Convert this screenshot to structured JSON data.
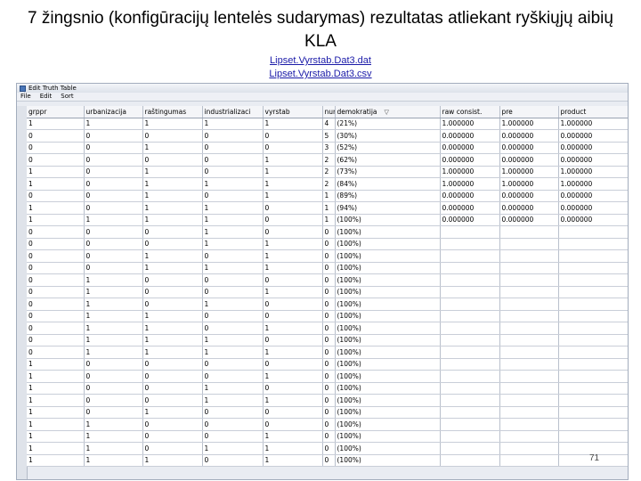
{
  "slide": {
    "title": "7 žingsnio (konfigūracijų lentelės sudarymas) rezultatas atliekant ryškiųjų aibių KLA",
    "links": [
      "Lipset.Vyrstab.Dat3.dat",
      "Lipset.Vyrstab.Dat3.csv"
    ],
    "page_number": "71"
  },
  "window": {
    "title": "Edit Truth Table",
    "menu": [
      "File",
      "Edit",
      "Sort"
    ]
  },
  "table": {
    "columns": [
      "grppr",
      "urbanizacija",
      "raštingumas",
      "industrializaci",
      "vyrstab",
      "number",
      "demokratija",
      "raw consist.",
      "pre",
      "product"
    ],
    "rows": [
      [
        "1",
        "1",
        "1",
        "1",
        "1",
        "4",
        "(21%)",
        "1.000000",
        "1.000000",
        "1.000000"
      ],
      [
        "0",
        "0",
        "0",
        "0",
        "0",
        "5",
        "(30%)",
        "0.000000",
        "0.000000",
        "0.000000"
      ],
      [
        "0",
        "0",
        "1",
        "0",
        "0",
        "3",
        "(52%)",
        "0.000000",
        "0.000000",
        "0.000000"
      ],
      [
        "0",
        "0",
        "0",
        "0",
        "1",
        "2",
        "(62%)",
        "0.000000",
        "0.000000",
        "0.000000"
      ],
      [
        "1",
        "0",
        "1",
        "0",
        "1",
        "2",
        "(73%)",
        "1.000000",
        "1.000000",
        "1.000000"
      ],
      [
        "1",
        "0",
        "1",
        "1",
        "1",
        "2",
        "(84%)",
        "1.000000",
        "1.000000",
        "1.000000"
      ],
      [
        "0",
        "0",
        "1",
        "0",
        "1",
        "1",
        "(89%)",
        "0.000000",
        "0.000000",
        "0.000000"
      ],
      [
        "1",
        "0",
        "1",
        "1",
        "0",
        "1",
        "(94%)",
        "0.000000",
        "0.000000",
        "0.000000"
      ],
      [
        "1",
        "1",
        "1",
        "1",
        "0",
        "1",
        "(100%)",
        "0.000000",
        "0.000000",
        "0.000000"
      ],
      [
        "0",
        "0",
        "0",
        "1",
        "0",
        "0",
        "(100%)",
        "",
        "",
        ""
      ],
      [
        "0",
        "0",
        "0",
        "1",
        "1",
        "0",
        "(100%)",
        "",
        "",
        ""
      ],
      [
        "0",
        "0",
        "1",
        "0",
        "1",
        "0",
        "(100%)",
        "",
        "",
        ""
      ],
      [
        "0",
        "0",
        "1",
        "1",
        "1",
        "0",
        "(100%)",
        "",
        "",
        ""
      ],
      [
        "0",
        "1",
        "0",
        "0",
        "0",
        "0",
        "(100%)",
        "",
        "",
        ""
      ],
      [
        "0",
        "1",
        "0",
        "0",
        "1",
        "0",
        "(100%)",
        "",
        "",
        ""
      ],
      [
        "0",
        "1",
        "0",
        "1",
        "0",
        "0",
        "(100%)",
        "",
        "",
        ""
      ],
      [
        "0",
        "1",
        "1",
        "0",
        "0",
        "0",
        "(100%)",
        "",
        "",
        ""
      ],
      [
        "0",
        "1",
        "1",
        "0",
        "1",
        "0",
        "(100%)",
        "",
        "",
        ""
      ],
      [
        "0",
        "1",
        "1",
        "1",
        "0",
        "0",
        "(100%)",
        "",
        "",
        ""
      ],
      [
        "0",
        "1",
        "1",
        "1",
        "1",
        "0",
        "(100%)",
        "",
        "",
        ""
      ],
      [
        "1",
        "0",
        "0",
        "0",
        "0",
        "0",
        "(100%)",
        "",
        "",
        ""
      ],
      [
        "1",
        "0",
        "0",
        "0",
        "1",
        "0",
        "(100%)",
        "",
        "",
        ""
      ],
      [
        "1",
        "0",
        "0",
        "1",
        "0",
        "0",
        "(100%)",
        "",
        "",
        ""
      ],
      [
        "1",
        "0",
        "0",
        "1",
        "1",
        "0",
        "(100%)",
        "",
        "",
        ""
      ],
      [
        "1",
        "0",
        "1",
        "0",
        "0",
        "0",
        "(100%)",
        "",
        "",
        ""
      ],
      [
        "1",
        "1",
        "0",
        "0",
        "0",
        "0",
        "(100%)",
        "",
        "",
        ""
      ],
      [
        "1",
        "1",
        "0",
        "0",
        "1",
        "0",
        "(100%)",
        "",
        "",
        ""
      ],
      [
        "1",
        "1",
        "0",
        "1",
        "1",
        "0",
        "(100%)",
        "",
        "",
        ""
      ],
      [
        "1",
        "1",
        "1",
        "0",
        "1",
        "0",
        "(100%)",
        "",
        "",
        ""
      ]
    ]
  }
}
